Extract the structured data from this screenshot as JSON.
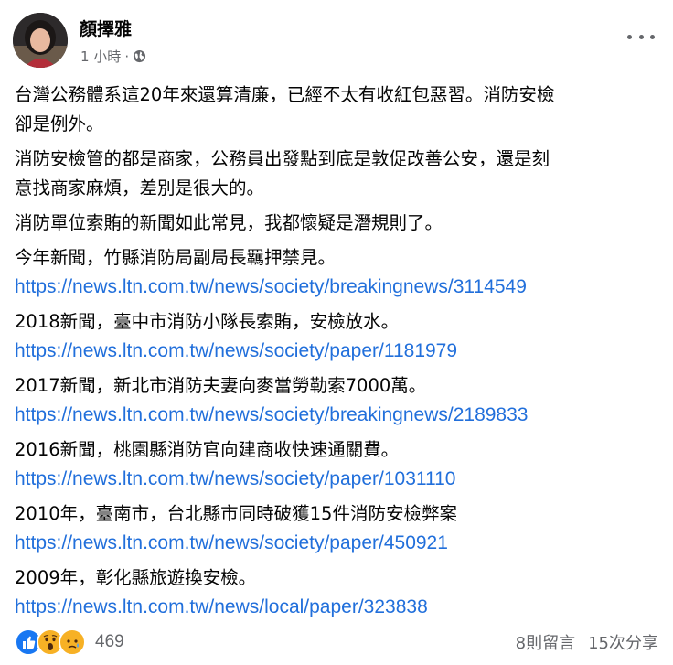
{
  "post": {
    "author": "顏擇雅",
    "time": "1 小時",
    "separator": "·",
    "paragraphs": [
      [
        "台灣公務體系這20年來還算清廉，已經不太有收紅包惡習。消防安檢",
        "卻是例外。"
      ],
      [
        "消防安檢管的都是商家，公務員出發點到底是敦促改善公安，還是刻",
        "意找商家麻煩，差別是很大的。"
      ],
      [
        "消防單位索賄的新聞如此常見，我都懷疑是潛規則了。"
      ]
    ],
    "news": [
      {
        "text": "今年新聞，竹縣消防局副局長羈押禁見。",
        "url": "https://news.ltn.com.tw/news/society/breakingnews/3114549"
      },
      {
        "text": "2018新聞，臺中市消防小隊長索賄，安檢放水。",
        "url": "https://news.ltn.com.tw/news/society/paper/1181979"
      },
      {
        "text": "2017新聞，新北市消防夫妻向麥當勞勒索7000萬。",
        "url": "https://news.ltn.com.tw/news/society/breakingnews/2189833"
      },
      {
        "text": "2016新聞，桃園縣消防官向建商收快速通關費。",
        "url": "https://news.ltn.com.tw/news/society/paper/1031110"
      },
      {
        "text": "2010年，臺南市，台北縣市同時破獲15件消防安檢弊案",
        "url": "https://news.ltn.com.tw/news/society/paper/450921"
      },
      {
        "text": "2009年，彰化縣旅遊換安檢。",
        "url": "https://news.ltn.com.tw/news/local/paper/323838"
      }
    ]
  },
  "footer": {
    "reaction_icons": [
      "like-icon",
      "wow-icon",
      "sad-icon"
    ],
    "reaction_count": "469",
    "comments": "8則留言",
    "shares": "15次分享"
  },
  "colors": {
    "link": "#216fdb",
    "secondary_text": "#65676b",
    "like": "#1877f2",
    "emoji": "#f7b125"
  }
}
